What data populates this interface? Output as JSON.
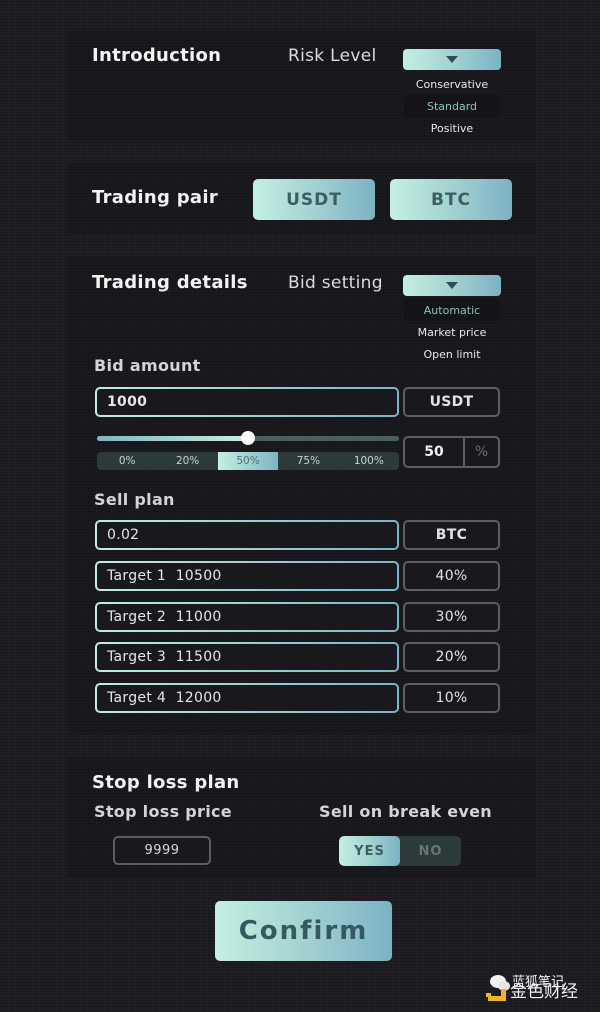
{
  "introduction": {
    "title": "Introduction",
    "risk_label": "Risk Level",
    "risk_options": [
      "Conservative",
      "Standard",
      "Positive"
    ],
    "risk_selected": "Standard"
  },
  "trading_pair": {
    "title": "Trading pair",
    "options": [
      "USDT",
      "BTC"
    ]
  },
  "trading_details": {
    "title": "Trading details",
    "bid_setting_label": "Bid setting",
    "bid_options": [
      "Automatic",
      "Market price",
      "Open limit"
    ],
    "bid_selected": "Automatic",
    "bid_amount_label": "Bid amount",
    "bid_amount_value": "1000",
    "bid_amount_unit": "USDT",
    "slider_percent": 50,
    "percent_value": "50",
    "percent_symbol": "%",
    "presets": [
      "0%",
      "20%",
      "50%",
      "75%",
      "100%"
    ],
    "preset_active": "50%",
    "sell_plan_label": "Sell plan",
    "sell_amount_value": "0.02",
    "sell_amount_unit": "BTC",
    "targets": [
      {
        "label": "Target 1  10500",
        "share": "40%"
      },
      {
        "label": "Target 2  11000",
        "share": "30%"
      },
      {
        "label": "Target 3  11500",
        "share": "20%"
      },
      {
        "label": "Target 4  12000",
        "share": "10%"
      }
    ]
  },
  "stop_loss": {
    "title": "Stop loss plan",
    "price_label": "Stop loss price",
    "price_value": "9999",
    "break_even_label": "Sell on break even",
    "toggle_yes": "YES",
    "toggle_no": "NO",
    "toggle_selected": "YES"
  },
  "confirm_label": "Confirm",
  "watermark": {
    "line1": "蓝狐笔记",
    "line2": "金色财经"
  },
  "colors": {
    "accent_gradient_start": "#c4efe1",
    "accent_gradient_end": "#7db2c6",
    "background": "#222127",
    "panel": "#141418",
    "accent_text": "#3d5f63"
  }
}
